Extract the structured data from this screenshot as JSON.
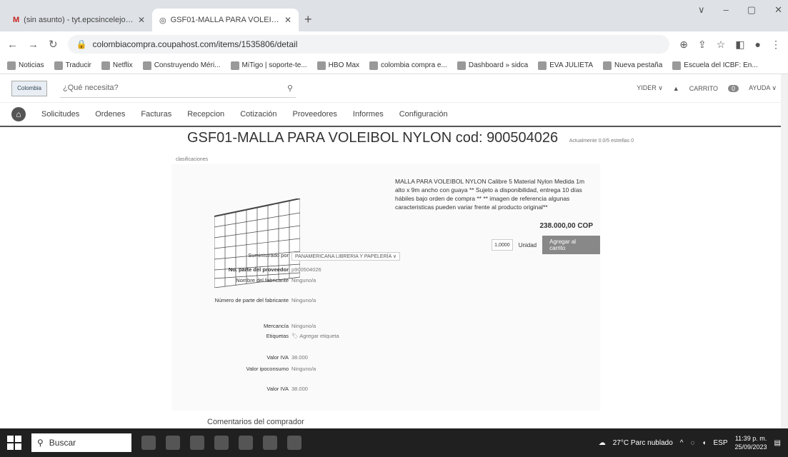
{
  "browser": {
    "tabs": [
      {
        "label": "(sin asunto) - tyt.epcsincelejo@..."
      },
      {
        "label": "GSF01-MALLA PARA VOLEIBOL N..."
      }
    ],
    "url": "colombiacompra.coupahost.com/items/1535806/detail",
    "bookmarks": [
      "Noticias",
      "Traducir",
      "Netflix",
      "Construyendo Méri...",
      "MiTigo | soporte-te...",
      "HBO Max",
      "colombia compra e...",
      "Dashboard » sidca",
      "EVA JULIETA",
      "Nueva pestaña",
      "Escuela del ICBF: En..."
    ]
  },
  "header": {
    "logo": "Colombia",
    "search_placeholder": "¿Qué necesita?",
    "user": "YIDER ∨",
    "cart": "CARRITO",
    "cart_count": "0",
    "help": "AYUDA ∨"
  },
  "nav": [
    "Solicitudes",
    "Ordenes",
    "Facturas",
    "Recepcion",
    "Cotización",
    "Proveedores",
    "Informes",
    "Configuración"
  ],
  "product": {
    "title": "GSF01-MALLA PARA VOLEIBOL NYLON cod: 900504026",
    "subtitle": "Actualmente 0.0/5 estrellas 0",
    "crumb": "clasificaciones",
    "description": "MALLA PARA VOLEIBOL NYLON Calibre 5 Material Nylon Medida 1m alto x 9m ancho con guaya ** Sujeto a disponibilidad, entrega 10 días hábiles bajo orden de compra ** ** imagen de referencia algunas caracteristicas pueden variar frente al producto original**",
    "price": "238.000,00 COP",
    "quantity": "1,0000",
    "unit": "Unidad",
    "add_button": "Agregar al carrito",
    "specs": [
      {
        "label": "Suministrado por",
        "value": "PANAMERICANA LIBRERIA Y PAPELERÍA ∨"
      },
      {
        "label": "No. parte del proveedor",
        "value": "p900504026"
      },
      {
        "label": "Nombre del fabricante",
        "value": "Ninguno/a"
      },
      {
        "label": "Número de parte del fabricante",
        "value": "Ninguno/a"
      },
      {
        "label": "Mercancía",
        "value": "Ninguno/a"
      },
      {
        "label": "Etiquetas",
        "value": "Agregar etiqueta"
      },
      {
        "label": "Valor IVA",
        "value": "38.000"
      },
      {
        "label": "Valor ipoconsumo",
        "value": "Ninguno/a"
      },
      {
        "label": "Valor IVA",
        "value": "38.000"
      }
    ]
  },
  "comments_label": "Comentarios del comprador",
  "taskbar": {
    "search": "Buscar",
    "weather": "27°C  Parc nublado",
    "lang": "ESP",
    "time": "11:39 p. m.",
    "date": "25/09/2023"
  }
}
